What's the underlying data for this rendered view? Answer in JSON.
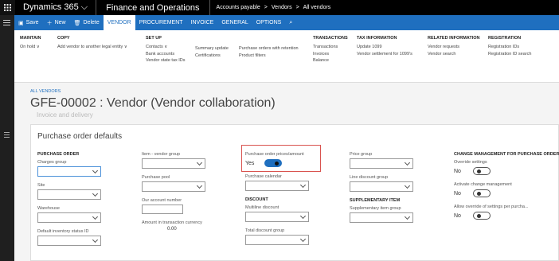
{
  "topbar": {
    "brand": "Dynamics 365",
    "app": "Finance and Operations",
    "crumbs": [
      "Accounts payable",
      ">",
      "Vendors",
      ">",
      "All vendors"
    ]
  },
  "actions": [
    {
      "icon": "save-icon",
      "label": "Save"
    },
    {
      "icon": "plus-icon",
      "label": "New"
    },
    {
      "icon": "trash-icon",
      "label": "Delete"
    },
    {
      "icon": "",
      "label": "VENDOR"
    },
    {
      "icon": "",
      "label": "PROCUREMENT"
    },
    {
      "icon": "",
      "label": "INVOICE"
    },
    {
      "icon": "",
      "label": "GENERAL"
    },
    {
      "icon": "",
      "label": "OPTIONS"
    }
  ],
  "ribbon": {
    "maintain": {
      "h": "MAINTAIN",
      "items": [
        "On hold ∨"
      ]
    },
    "copy": {
      "h": "COPY",
      "items": [
        "Add vendor to another legal entity ∨"
      ]
    },
    "setup": {
      "h": "SET UP",
      "items": [
        "Contacts ∨",
        "Bank accounts",
        "Vendor state tax IDs"
      ]
    },
    "setup2": {
      "items": [
        "Summary update",
        "Certifications"
      ]
    },
    "setup3": {
      "items": [
        "Purchase orders with retention",
        "Product filters"
      ]
    },
    "transactions": {
      "h": "TRANSACTIONS",
      "items": [
        "Transactions",
        "Invoices",
        "Balance"
      ]
    },
    "tax": {
      "h": "TAX INFORMATION",
      "items": [
        "Update 1099",
        "Vendor settlement for 1099's"
      ]
    },
    "related": {
      "h": "RELATED INFORMATION",
      "items": [
        "Vendor requests",
        "Vendor search"
      ]
    },
    "registration": {
      "h": "REGISTRATION",
      "items": [
        "Registration IDs",
        "Registration ID search"
      ]
    }
  },
  "page": {
    "all_vendors": "ALL VENDORS",
    "title": "GFE-00002 : Vendor (Vendor collaboration)",
    "ghost": "Invoice and delivery"
  },
  "card": {
    "heading": "Purchase order defaults",
    "col1": {
      "hdr": "PURCHASE ORDER",
      "charges": "Charges group",
      "site": "Site",
      "warehouse": "Warehouse",
      "inv_status": "Default inventory status ID"
    },
    "col2": {
      "item_vendor_group": "Item - vendor group",
      "purchase_pool": "Purchase pool",
      "our_account": "Our account number",
      "amount_label": "Amount in transaction currency",
      "amount_value": "0.00"
    },
    "col3": {
      "po_prices": "Purchase order prices/amount",
      "po_prices_value": "Yes",
      "purchase_calendar": "Purchase calendar",
      "discount_hdr": "DISCOUNT",
      "multiline": "Multiline discount",
      "total_discount": "Total discount group"
    },
    "col4": {
      "price_group": "Price group",
      "line_discount": "Line discount group",
      "supp_hdr": "SUPPLEMENTARY ITEM",
      "supp_group": "Supplementary item group"
    },
    "col5": {
      "hdr": "CHANGE MANAGEMENT FOR PURCHASE ORDERS",
      "override": "Override settings",
      "override_v": "No",
      "activate": "Activate change management",
      "activate_v": "No",
      "allow": "Allow override of settings per purcha...",
      "allow_v": "No"
    }
  },
  "colors": {
    "accent": "#1f6fbf",
    "highlight": "#d9534f"
  }
}
